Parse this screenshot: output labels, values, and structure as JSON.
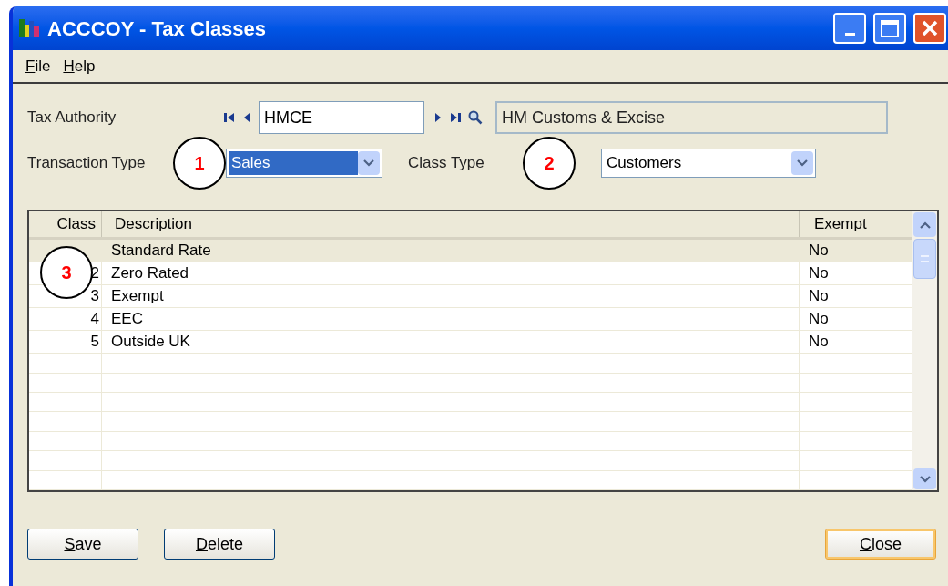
{
  "window": {
    "title": "ACCCOY - Tax Classes"
  },
  "menu": [
    {
      "accel": "F",
      "rest": "ile"
    },
    {
      "accel": "H",
      "rest": "elp"
    }
  ],
  "tax_authority": {
    "label": "Tax Authority",
    "code": "HMCE",
    "name": "HM Customs & Excise"
  },
  "transaction_type": {
    "label": "Transaction Type",
    "value": "Sales",
    "focused": true
  },
  "class_type": {
    "label": "Class Type",
    "value": "Customers",
    "focused": false
  },
  "callouts": [
    "1",
    "2",
    "3"
  ],
  "table": {
    "columns": [
      "Class",
      "Description",
      "Exempt"
    ],
    "rows": [
      {
        "class": "",
        "description": "Standard Rate",
        "exempt": "No",
        "selected": true
      },
      {
        "class": "2",
        "description": "Zero Rated",
        "exempt": "No",
        "selected": false
      },
      {
        "class": "3",
        "description": "Exempt",
        "exempt": "No",
        "selected": false
      },
      {
        "class": "4",
        "description": "EEC",
        "exempt": "No",
        "selected": false
      },
      {
        "class": "5",
        "description": "Outside UK",
        "exempt": "No",
        "selected": false
      }
    ]
  },
  "buttons": [
    {
      "accel": "S",
      "rest": "ave",
      "kind": "left",
      "default": false
    },
    {
      "accel": "D",
      "rest": "elete",
      "kind": "left",
      "default": false
    },
    {
      "accel": "C",
      "rest": "lose",
      "kind": "right",
      "default": true
    }
  ]
}
